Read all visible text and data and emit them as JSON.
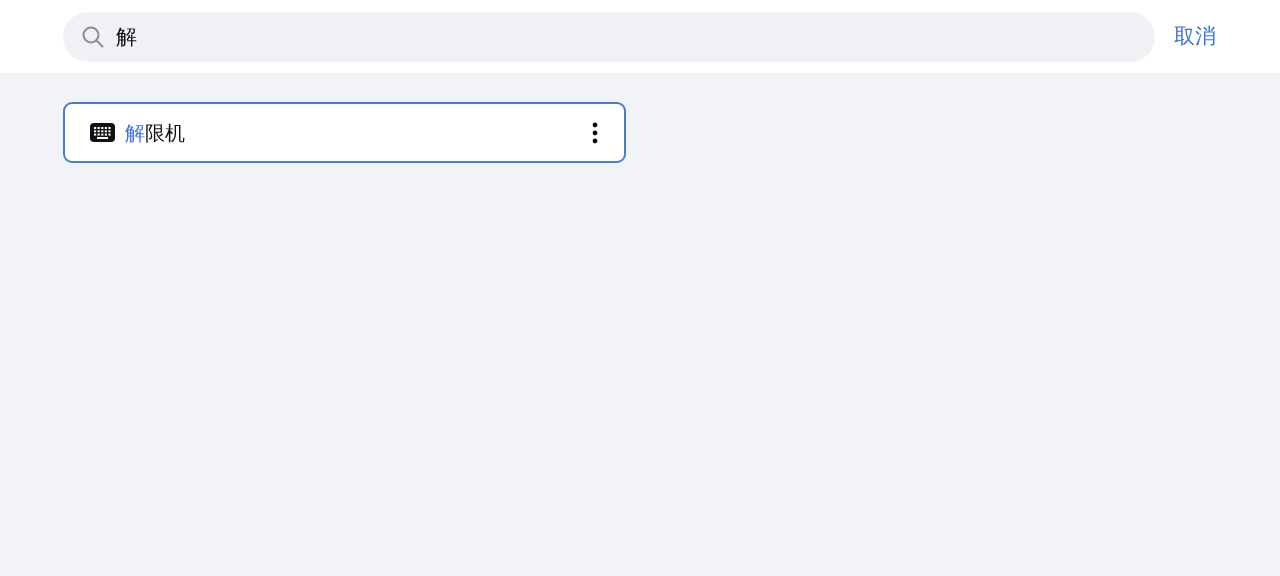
{
  "search": {
    "value": "解"
  },
  "cancel_button": "取消",
  "results": [
    {
      "kind": "keyboard",
      "match": "解",
      "rest": "限机",
      "selected": true
    }
  ]
}
